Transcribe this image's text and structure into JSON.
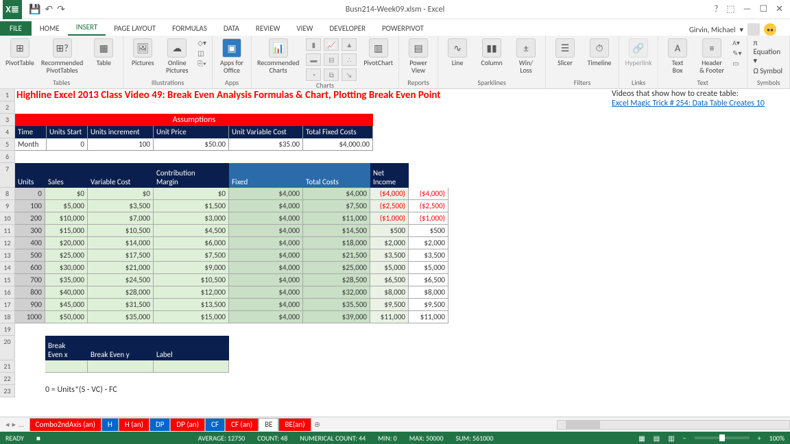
{
  "window": {
    "title": "Busn214-Week09.xlsm - Excel",
    "app_short": "X≣"
  },
  "user": {
    "name": "Girvin, Michael"
  },
  "tabs": [
    "HOME",
    "INSERT",
    "PAGE LAYOUT",
    "FORMULAS",
    "DATA",
    "REVIEW",
    "VIEW",
    "DEVELOPER",
    "POWERPIVOT"
  ],
  "file_tab": "FILE",
  "ribbon": {
    "groups": {
      "tables": {
        "label": "Tables",
        "pivottable": "PivotTable",
        "recpt": "Recommended\nPivotTables",
        "table": "Table"
      },
      "illus": {
        "label": "Illustrations",
        "pictures": "Pictures",
        "online": "Online\nPictures"
      },
      "apps": {
        "label": "Apps",
        "appsfor": "Apps for\nOffice"
      },
      "charts": {
        "label": "Charts",
        "rec": "Recommended\nCharts",
        "pivotchart": "PivotChart"
      },
      "reports": {
        "label": "Reports",
        "pv": "Power\nView"
      },
      "spark": {
        "label": "Sparklines",
        "line": "Line",
        "col": "Column",
        "wl": "Win/\nLoss"
      },
      "filters": {
        "label": "Filters",
        "slicer": "Slicer",
        "tl": "Timeline"
      },
      "links": {
        "label": "Links",
        "hl": "Hyperlink"
      },
      "text": {
        "label": "Text",
        "tb": "Text\nBox",
        "hf": "Header\n& Footer"
      },
      "symbols": {
        "label": "Symbols",
        "eq": "Equation",
        "sy": "Symbol"
      }
    }
  },
  "sheet": {
    "title": "Highline Excel 2013 Class Video 49: Break Even Analysis Formulas & Chart, Plotting Break Even Point",
    "right_text": "Videos that show how to create table:",
    "right_link": "Excel Magic Trick # 254: Data Table Creates 10",
    "assumptions": {
      "title": "Assumptions",
      "headers": {
        "time": "Time",
        "ustart": "Units Start",
        "uinc": "Units increment",
        "uprice": "Unit Price",
        "uvc": "Unit Variable Cost",
        "tfc": "Total Fixed Costs"
      },
      "row": {
        "time": "Month",
        "ustart": "0",
        "uinc": "100",
        "uprice": "$50.00",
        "uvc": "$35.00",
        "tfc": "$4,000.00"
      }
    },
    "main_headers": {
      "units": "Units",
      "sales": "Sales",
      "vc": "Variable Cost",
      "cm": "Contribution\nMargin",
      "fixed": "Fixed",
      "tc": "Total Costs",
      "ni": "Net\nIncome"
    },
    "rows": [
      {
        "u": "0",
        "s": "$0",
        "vc": "$0",
        "cm": "$0",
        "fx": "$4,000",
        "tc": "$4,000",
        "ni": "($4,000)",
        "ni2": "($4,000)"
      },
      {
        "u": "100",
        "s": "$5,000",
        "vc": "$3,500",
        "cm": "$1,500",
        "fx": "$4,000",
        "tc": "$7,500",
        "ni": "($2,500)",
        "ni2": "($2,500)"
      },
      {
        "u": "200",
        "s": "$10,000",
        "vc": "$7,000",
        "cm": "$3,000",
        "fx": "$4,000",
        "tc": "$11,000",
        "ni": "($1,000)",
        "ni2": "($1,000)"
      },
      {
        "u": "300",
        "s": "$15,000",
        "vc": "$10,500",
        "cm": "$4,500",
        "fx": "$4,000",
        "tc": "$14,500",
        "ni": "$500",
        "ni2": "$500"
      },
      {
        "u": "400",
        "s": "$20,000",
        "vc": "$14,000",
        "cm": "$6,000",
        "fx": "$4,000",
        "tc": "$18,000",
        "ni": "$2,000",
        "ni2": "$2,000"
      },
      {
        "u": "500",
        "s": "$25,000",
        "vc": "$17,500",
        "cm": "$7,500",
        "fx": "$4,000",
        "tc": "$21,500",
        "ni": "$3,500",
        "ni2": "$3,500"
      },
      {
        "u": "600",
        "s": "$30,000",
        "vc": "$21,000",
        "cm": "$9,000",
        "fx": "$4,000",
        "tc": "$25,000",
        "ni": "$5,000",
        "ni2": "$5,000"
      },
      {
        "u": "700",
        "s": "$35,000",
        "vc": "$24,500",
        "cm": "$10,500",
        "fx": "$4,000",
        "tc": "$28,500",
        "ni": "$6,500",
        "ni2": "$6,500"
      },
      {
        "u": "800",
        "s": "$40,000",
        "vc": "$28,000",
        "cm": "$12,000",
        "fx": "$4,000",
        "tc": "$32,000",
        "ni": "$8,000",
        "ni2": "$8,000"
      },
      {
        "u": "900",
        "s": "$45,000",
        "vc": "$31,500",
        "cm": "$13,500",
        "fx": "$4,000",
        "tc": "$35,500",
        "ni": "$9,500",
        "ni2": "$9,500"
      },
      {
        "u": "1000",
        "s": "$50,000",
        "vc": "$35,000",
        "cm": "$15,000",
        "fx": "$4,000",
        "tc": "$39,000",
        "ni": "$11,000",
        "ni2": "$11,000"
      }
    ],
    "break_even": {
      "x": "Break\nEven x",
      "y": "Break Even y",
      "label": "Label"
    },
    "formula": "0 = Units*(S - VC) - FC",
    "row_nums": [
      "1",
      "2",
      "3",
      "4",
      "5",
      "6",
      "7",
      "8",
      "9",
      "10",
      "11",
      "12",
      "13",
      "14",
      "15",
      "16",
      "17",
      "18",
      "19",
      "20",
      "21",
      "22",
      "23"
    ]
  },
  "sheet_tabs": [
    {
      "name": "Combo2ndAxis (an)",
      "cls": "red"
    },
    {
      "name": "H",
      "cls": "blue"
    },
    {
      "name": "H (an)",
      "cls": "red"
    },
    {
      "name": "DP",
      "cls": "blue"
    },
    {
      "name": "DP (an)",
      "cls": "red"
    },
    {
      "name": "CF",
      "cls": "blue"
    },
    {
      "name": "CF (an)",
      "cls": "red"
    },
    {
      "name": "BE",
      "cls": "active"
    },
    {
      "name": "BE(an)",
      "cls": "red"
    }
  ],
  "status": {
    "ready": "READY",
    "avg": "AVERAGE: 12750",
    "count": "COUNT: 48",
    "numcount": "NUMERICAL COUNT: 44",
    "min": "MIN: 0",
    "max": "MAX: 50000",
    "sum": "SUM: 561000",
    "zoom": "100%"
  }
}
